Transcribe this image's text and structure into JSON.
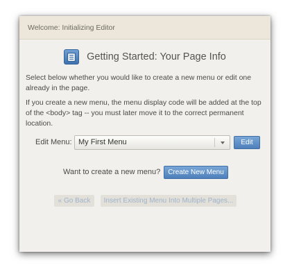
{
  "dialog": {
    "title": "Welcome: Initializing Editor",
    "heading": "Getting Started: Your Page Info",
    "heading_icon": "document-list-icon",
    "paragraph1": "Select below whether you would like to create a new menu or edit one already in the page.",
    "paragraph2": "If you create a new menu, the menu display code will be added at the top of the <body> tag -- you must later move it to the correct permanent location.",
    "edit_menu": {
      "label": "Edit Menu:",
      "selected": "My First Menu",
      "edit_button": "Edit"
    },
    "create": {
      "prompt": "Want to create a new menu?",
      "button": "Create New Menu"
    },
    "footer": {
      "back_button": "« Go Back",
      "insert_button": "Insert Existing Menu Into Multiple Pages..."
    }
  },
  "colors": {
    "accent": "#4d7fbb",
    "titlebar": "#ece7da",
    "panel": "#f1f0ec"
  }
}
